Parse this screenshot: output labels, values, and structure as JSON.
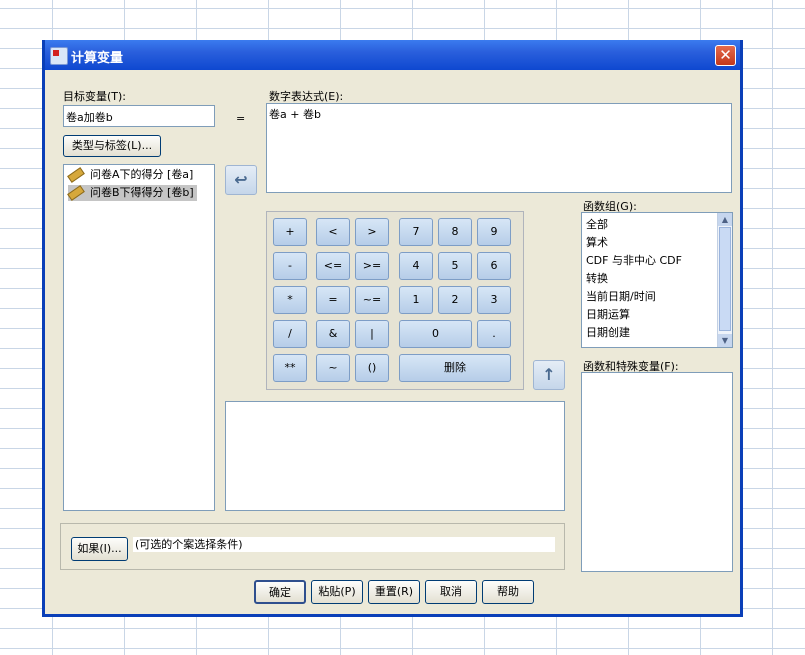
{
  "window": {
    "title": "计算变量",
    "close_glyph": "✕"
  },
  "target_variable": {
    "label": "目标变量(T):",
    "value": "卷a加卷b"
  },
  "equals": "=",
  "type_label_button": "类型与标签(L)...",
  "variables": [
    {
      "label": "问卷A下的得分 [卷a]",
      "selected": false
    },
    {
      "label": "问卷B下得得分 [卷b]",
      "selected": true
    }
  ],
  "move_arrow_icon": "arrow-left-icon",
  "expression": {
    "label": "数字表达式(E):",
    "value": "卷a + 卷b"
  },
  "keypad": {
    "ops": [
      "+",
      "<",
      ">",
      "-",
      "<=",
      ">=",
      "*",
      "=",
      "~=",
      "/",
      "&",
      "|",
      "**",
      "~",
      "()"
    ],
    "digits": [
      "7",
      "8",
      "9",
      "4",
      "5",
      "6",
      "1",
      "2",
      "3",
      "0",
      "."
    ],
    "delete": "删除"
  },
  "function_group": {
    "label": "函数组(G):",
    "items": [
      "全部",
      "算术",
      "CDF 与非中心 CDF",
      "转换",
      "当前日期/时间",
      "日期运算",
      "日期创建"
    ]
  },
  "functions_label": "函数和特殊变量(F):",
  "if_button": "如果(I)...",
  "if_condition": "(可选的个案选择条件)",
  "footer_buttons": [
    "确定",
    "粘贴(P)",
    "重置(R)",
    "取消",
    "帮助"
  ]
}
